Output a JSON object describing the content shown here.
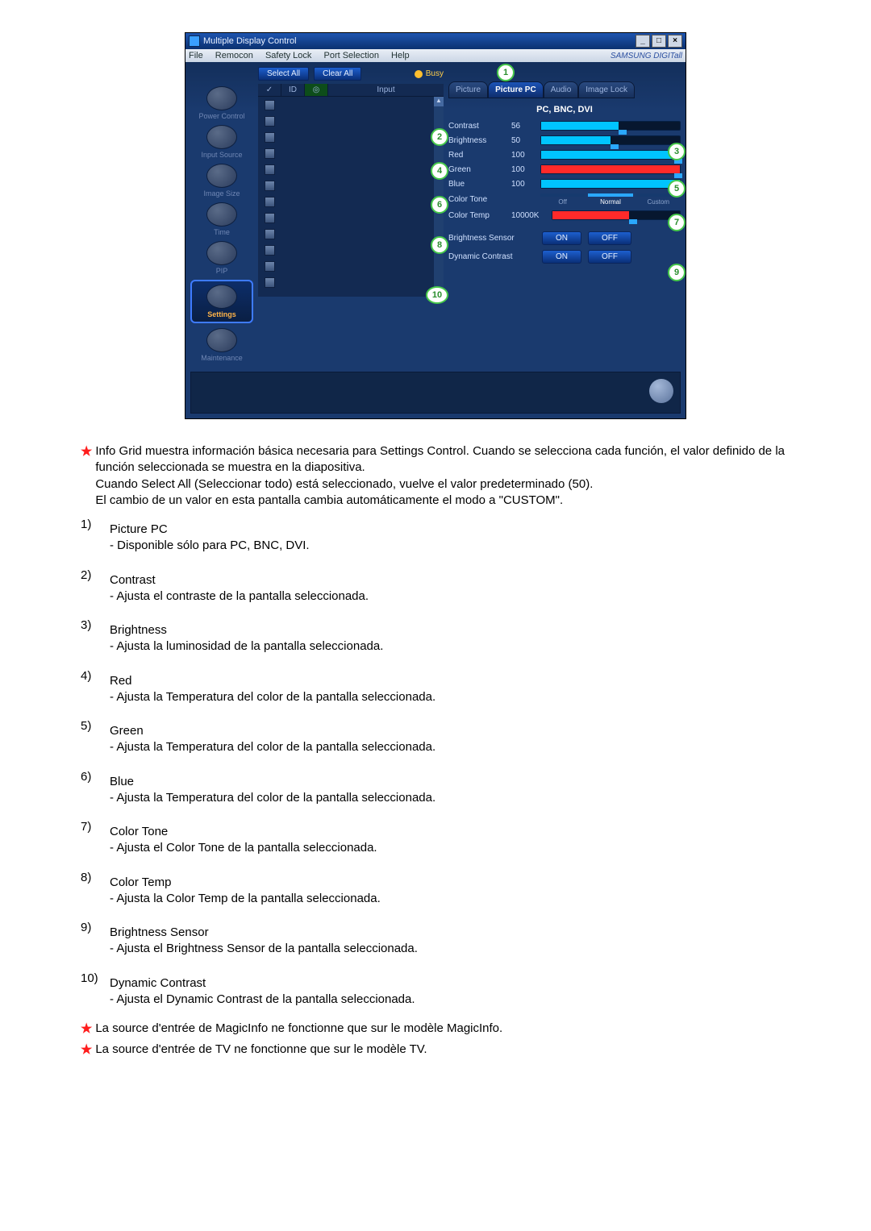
{
  "app": {
    "title": "Multiple Display Control",
    "menus": [
      "File",
      "Remocon",
      "Safety Lock",
      "Port Selection",
      "Help"
    ],
    "brand": "SAMSUNG DIGITall",
    "win": {
      "min": "_",
      "max": "□",
      "close": "×"
    },
    "sidebar": [
      {
        "label": "Power Control"
      },
      {
        "label": "Input Source"
      },
      {
        "label": "Image Size"
      },
      {
        "label": "Time"
      },
      {
        "label": "PIP"
      },
      {
        "label": "Settings",
        "selected": true
      },
      {
        "label": "Maintenance"
      }
    ],
    "buttons": {
      "select_all": "Select All",
      "clear_all": "Clear All",
      "busy": "Busy"
    },
    "grid_head": {
      "id": "ID",
      "input": "Input"
    },
    "grid_rows": 12,
    "tabs": [
      "Picture",
      "Picture PC",
      "Audio",
      "Image Lock"
    ],
    "tab_active_idx": 1,
    "subtitle": "PC, BNC, DVI",
    "sliders": [
      {
        "label": "Contrast",
        "val": "56",
        "pct": 56,
        "color": "blue"
      },
      {
        "label": "Brightness",
        "val": "50",
        "pct": 50,
        "color": "blue"
      },
      {
        "label": "Red",
        "val": "100",
        "pct": 100,
        "color": "blue"
      },
      {
        "label": "Green",
        "val": "100",
        "pct": 100,
        "color": "red"
      },
      {
        "label": "Blue",
        "val": "100",
        "pct": 100,
        "color": "blue"
      }
    ],
    "color_tone": {
      "label": "Color Tone",
      "opts": [
        "Off",
        "Normal",
        "Custom"
      ],
      "sel": 1
    },
    "color_temp": {
      "label": "Color Temp",
      "val": "10000K",
      "pct": 60
    },
    "bsensor": {
      "label": "Brightness Sensor",
      "on": "ON",
      "off": "OFF"
    },
    "dcontrast": {
      "label": "Dynamic Contrast",
      "on": "ON",
      "off": "OFF"
    },
    "callouts": [
      "1",
      "2",
      "3",
      "4",
      "5",
      "6",
      "7",
      "8",
      "9",
      "10"
    ]
  },
  "doc": {
    "intro": "Info Grid muestra información básica necesaria para Settings Control. Cuando se selecciona cada función, el valor definido de la función seleccionada se muestra en la diapositiva.\nCuando Select All (Seleccionar todo) está seleccionado, vuelve el valor predeterminado (50).\nEl cambio de un valor en esta pantalla cambia automáticamente el modo a \"CUSTOM\".",
    "items": [
      {
        "n": "1)",
        "t": "Picture PC",
        "d": "- Disponible sólo para PC, BNC, DVI."
      },
      {
        "n": "2)",
        "t": "Contrast",
        "d": "- Ajusta el contraste de la pantalla seleccionada."
      },
      {
        "n": "3)",
        "t": "Brightness",
        "d": "- Ajusta la luminosidad de la pantalla seleccionada."
      },
      {
        "n": "4)",
        "t": "Red",
        "d": "- Ajusta la Temperatura del color de la pantalla seleccionada."
      },
      {
        "n": "5)",
        "t": "Green",
        "d": "- Ajusta la Temperatura del color de la pantalla seleccionada."
      },
      {
        "n": "6)",
        "t": "Blue",
        "d": "- Ajusta la Temperatura del color de la pantalla seleccionada."
      },
      {
        "n": "7)",
        "t": "Color Tone",
        "d": "- Ajusta el Color Tone de la pantalla seleccionada."
      },
      {
        "n": "8)",
        "t": "Color Temp",
        "d": "- Ajusta la Color Temp de la pantalla seleccionada."
      },
      {
        "n": "9)",
        "t": "Brightness Sensor",
        "d": "- Ajusta el Brightness Sensor de la pantalla seleccionada."
      },
      {
        "n": "10)",
        "t": "Dynamic Contrast",
        "d": "- Ajusta el Dynamic Contrast de la pantalla seleccionada."
      }
    ],
    "foot1": "La source d'entrée de MagicInfo ne fonctionne que sur le modèle MagicInfo.",
    "foot2": "La source d'entrée de TV ne fonctionne que sur le modèle TV."
  }
}
